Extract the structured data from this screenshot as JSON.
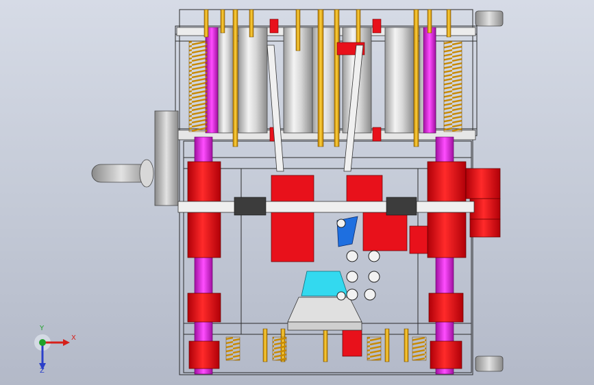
{
  "viewport": {
    "triad": {
      "x_label": "X",
      "y_label": "Y",
      "z_label": "Z",
      "x_color": "#d6201a",
      "y_color": "#1fa22a",
      "z_color": "#2b3fc9"
    }
  },
  "colors": {
    "background_top": "#d6dbe6",
    "background_bottom": "#b3b9c8",
    "red_parts": "#e8111b",
    "magenta_guides": "#e61ee6",
    "pin_orange": "#ffb400",
    "cyan_insert": "#33d9ef",
    "blue_block": "#1e6fe0"
  }
}
